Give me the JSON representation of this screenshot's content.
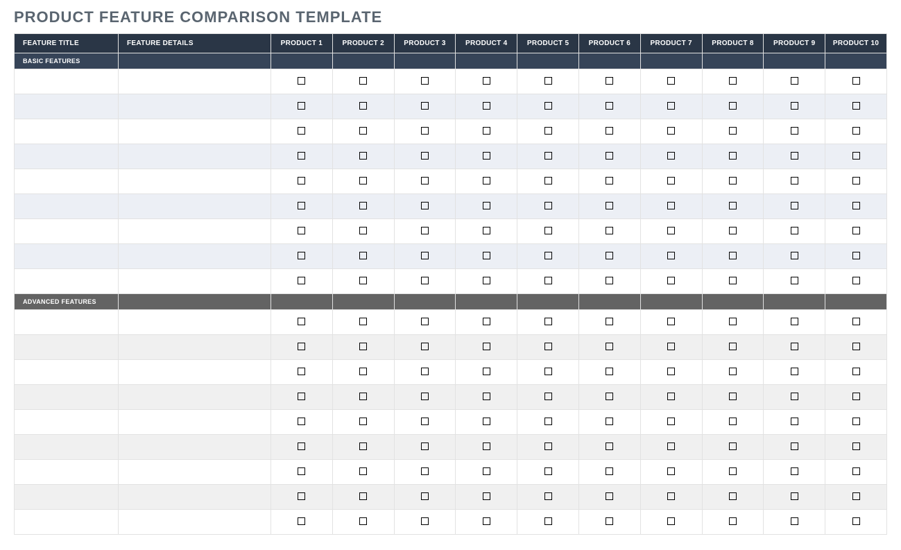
{
  "title": "PRODUCT FEATURE COMPARISON TEMPLATE",
  "columns": {
    "feature_title": "FEATURE TITLE",
    "feature_details": "FEATURE DETAILS",
    "products": [
      "PRODUCT 1",
      "PRODUCT 2",
      "PRODUCT 3",
      "PRODUCT 4",
      "PRODUCT 5",
      "PRODUCT 6",
      "PRODUCT 7",
      "PRODUCT 8",
      "PRODUCT 9",
      "PRODUCT 10"
    ]
  },
  "sections": [
    {
      "label": "BASIC FEATURES",
      "style": "basic",
      "rows": [
        {
          "title": "",
          "details": "",
          "checks": [
            false,
            false,
            false,
            false,
            false,
            false,
            false,
            false,
            false,
            false
          ]
        },
        {
          "title": "",
          "details": "",
          "checks": [
            false,
            false,
            false,
            false,
            false,
            false,
            false,
            false,
            false,
            false
          ]
        },
        {
          "title": "",
          "details": "",
          "checks": [
            false,
            false,
            false,
            false,
            false,
            false,
            false,
            false,
            false,
            false
          ]
        },
        {
          "title": "",
          "details": "",
          "checks": [
            false,
            false,
            false,
            false,
            false,
            false,
            false,
            false,
            false,
            false
          ]
        },
        {
          "title": "",
          "details": "",
          "checks": [
            false,
            false,
            false,
            false,
            false,
            false,
            false,
            false,
            false,
            false
          ]
        },
        {
          "title": "",
          "details": "",
          "checks": [
            false,
            false,
            false,
            false,
            false,
            false,
            false,
            false,
            false,
            false
          ]
        },
        {
          "title": "",
          "details": "",
          "checks": [
            false,
            false,
            false,
            false,
            false,
            false,
            false,
            false,
            false,
            false
          ]
        },
        {
          "title": "",
          "details": "",
          "checks": [
            false,
            false,
            false,
            false,
            false,
            false,
            false,
            false,
            false,
            false
          ]
        },
        {
          "title": "",
          "details": "",
          "checks": [
            false,
            false,
            false,
            false,
            false,
            false,
            false,
            false,
            false,
            false
          ]
        }
      ]
    },
    {
      "label": "ADVANCED FEATURES",
      "style": "advanced",
      "rows": [
        {
          "title": "",
          "details": "",
          "checks": [
            false,
            false,
            false,
            false,
            false,
            false,
            false,
            false,
            false,
            false
          ]
        },
        {
          "title": "",
          "details": "",
          "checks": [
            false,
            false,
            false,
            false,
            false,
            false,
            false,
            false,
            false,
            false
          ]
        },
        {
          "title": "",
          "details": "",
          "checks": [
            false,
            false,
            false,
            false,
            false,
            false,
            false,
            false,
            false,
            false
          ]
        },
        {
          "title": "",
          "details": "",
          "checks": [
            false,
            false,
            false,
            false,
            false,
            false,
            false,
            false,
            false,
            false
          ]
        },
        {
          "title": "",
          "details": "",
          "checks": [
            false,
            false,
            false,
            false,
            false,
            false,
            false,
            false,
            false,
            false
          ]
        },
        {
          "title": "",
          "details": "",
          "checks": [
            false,
            false,
            false,
            false,
            false,
            false,
            false,
            false,
            false,
            false
          ]
        },
        {
          "title": "",
          "details": "",
          "checks": [
            false,
            false,
            false,
            false,
            false,
            false,
            false,
            false,
            false,
            false
          ]
        },
        {
          "title": "",
          "details": "",
          "checks": [
            false,
            false,
            false,
            false,
            false,
            false,
            false,
            false,
            false,
            false
          ]
        },
        {
          "title": "",
          "details": "",
          "checks": [
            false,
            false,
            false,
            false,
            false,
            false,
            false,
            false,
            false,
            false
          ]
        }
      ]
    }
  ]
}
